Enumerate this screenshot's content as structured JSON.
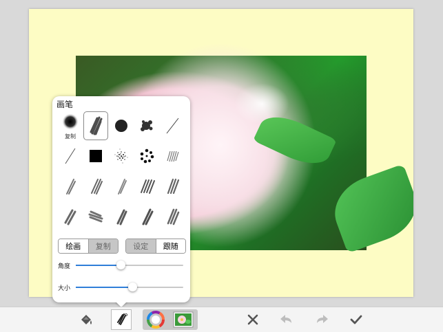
{
  "brush_panel": {
    "title": "画笔",
    "first_brush_caption": "复制",
    "mode_segment": {
      "paint_label": "绘画",
      "copy_label": "复制",
      "selected": "paint_label"
    },
    "follow_segment": {
      "settings_label": "设定",
      "follow_label": "跟随",
      "selected": "follow_label"
    },
    "angle": {
      "label": "角度",
      "value": 0.42
    },
    "size": {
      "label": "大小",
      "value": 0.53
    }
  },
  "toolbar": {
    "icons": [
      "paint-bucket-icon",
      "brush-icon",
      "color-wheel-icon",
      "photo-thumbnail-icon",
      "close-icon",
      "undo-icon",
      "redo-icon",
      "check-icon"
    ]
  },
  "colors": {
    "paper": "#fdfcc4",
    "accent": "#2f7ed8",
    "panel": "#ffffff"
  }
}
